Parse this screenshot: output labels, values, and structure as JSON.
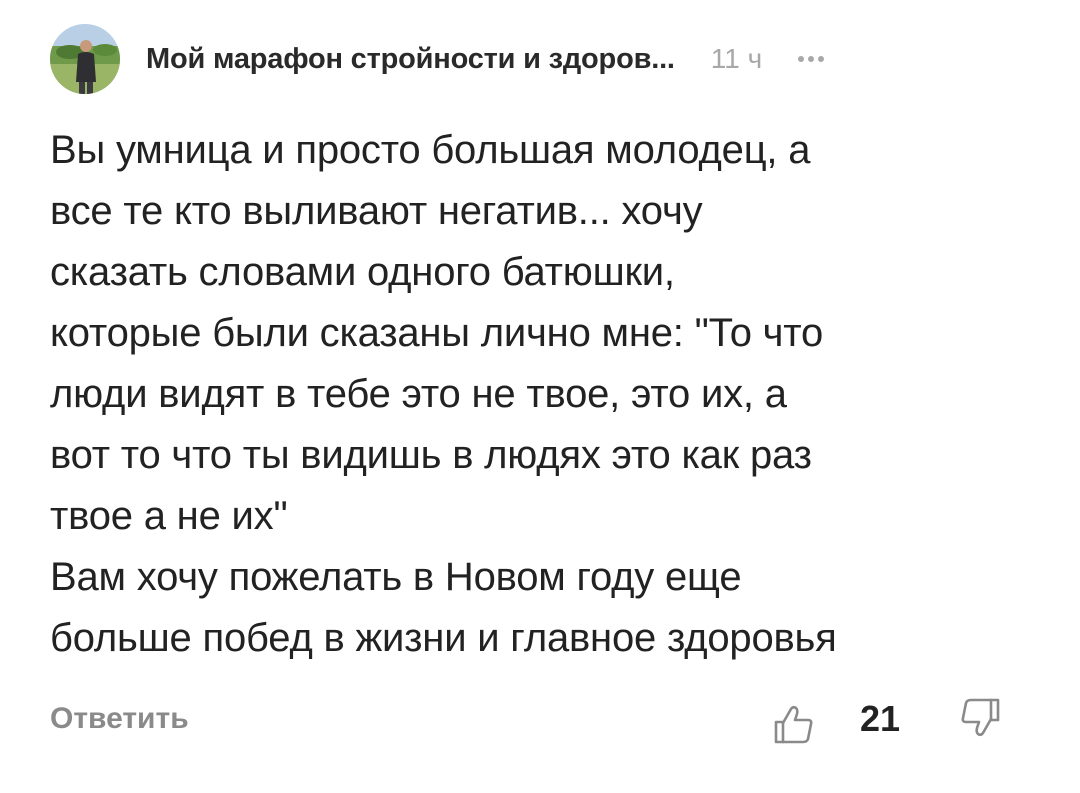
{
  "comment": {
    "author": "Мой марафон стройности и здоров...",
    "time": "11 ч",
    "more_icon": "more-dots-icon",
    "body_lines": [
      "Вы умница и просто большая молодец, а",
      "все те кто выливают негатив... хочу",
      "сказать словами одного батюшки,",
      "которые были сказаны лично мне: \"То что",
      "люди видят в тебе это не твое, это их, а",
      "вот то что ты видишь в людях это как раз",
      "твое а не их\"",
      "Вам хочу пожелать в Новом году еще",
      "больше побед в жизни и главное здоровья"
    ],
    "reply_label": "Ответить",
    "like_count": "21",
    "like_icon": "thumbs-up-icon",
    "dislike_icon": "thumbs-down-icon"
  },
  "colors": {
    "text": "#222222",
    "muted": "#a8a8a8",
    "reply": "#8a8a8a",
    "background": "#ffffff"
  }
}
